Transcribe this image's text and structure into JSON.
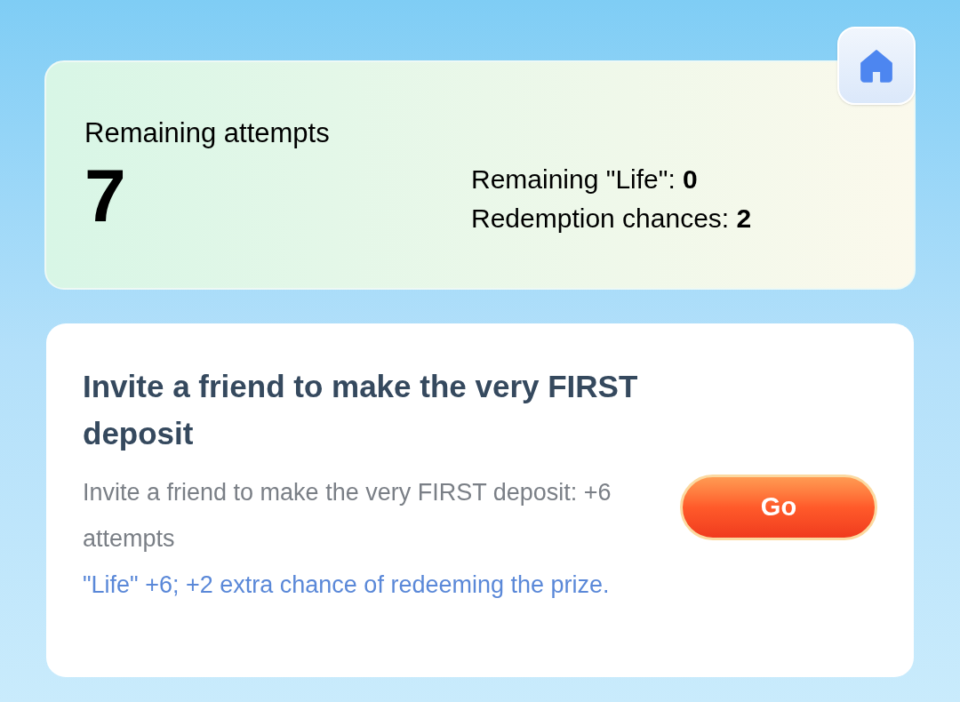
{
  "summary": {
    "title": "Remaining attempts",
    "attempts": "7",
    "stats": [
      "Remaining \"Life\": **0**",
      "Redemption chances: **2**"
    ]
  },
  "task": {
    "title": "Invite a friend to make the very FIRST deposit",
    "description": "Invite a friend to make the very FIRST deposit: +6 attempts",
    "bonus": "\"Life\" +6; +2 extra chance of redeeming the prize.",
    "button": "Go"
  }
}
